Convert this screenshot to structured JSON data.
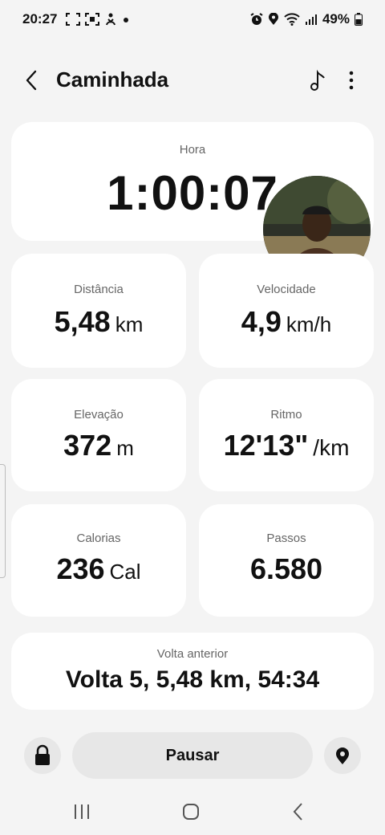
{
  "status_bar": {
    "time": "20:27",
    "battery": "49%",
    "icons": [
      "screenshot-icon",
      "screen-record-icon",
      "accessibility-icon",
      "dot-icon",
      "alarm-icon",
      "location-icon",
      "wifi-icon",
      "signal-icon",
      "battery-icon"
    ]
  },
  "header": {
    "title": "Caminhada",
    "icons": [
      "back-icon",
      "music-note-icon",
      "more-options-icon"
    ]
  },
  "time_card": {
    "label": "Hora",
    "value": "1:00:07"
  },
  "stats": {
    "distance": {
      "label": "Distância",
      "value": "5,48",
      "unit": "km"
    },
    "speed": {
      "label": "Velocidade",
      "value": "4,9",
      "unit": "km/h"
    },
    "elevation": {
      "label": "Elevação",
      "value": "372",
      "unit": "m"
    },
    "pace": {
      "label": "Ritmo",
      "value": "12'13\"",
      "unit": "/km"
    },
    "calories": {
      "label": "Calorias",
      "value": "236",
      "unit": "Cal"
    },
    "steps": {
      "label": "Passos",
      "value": "6.580"
    }
  },
  "lap_card": {
    "label": "Volta anterior",
    "value": "Volta 5, 5,48 km, 54:34"
  },
  "controls": {
    "pause_label": "Pausar"
  },
  "colors": {
    "background": "#f4f4f4",
    "card": "#ffffff",
    "button": "#e7e7e7",
    "text": "#111111",
    "label": "#666666"
  }
}
